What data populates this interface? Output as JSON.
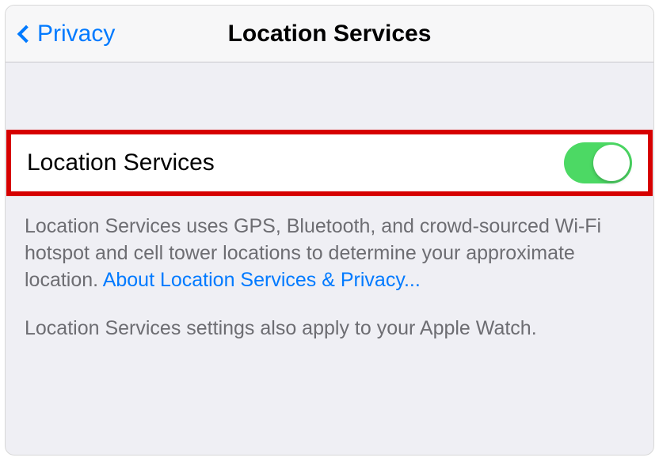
{
  "nav": {
    "back_label": "Privacy",
    "title": "Location Services"
  },
  "main_toggle": {
    "label": "Location Services",
    "enabled": true
  },
  "description": {
    "text": "Location Services uses GPS, Bluetooth, and crowd-sourced Wi-Fi hotspot and cell tower locations to determine your approximate location. ",
    "link_text": "About Location Services & Privacy..."
  },
  "watch_note": "Location Services settings also apply to your Apple Watch.",
  "colors": {
    "accent": "#007aff",
    "toggle_on": "#4cd964",
    "highlight_border": "#d60000"
  }
}
